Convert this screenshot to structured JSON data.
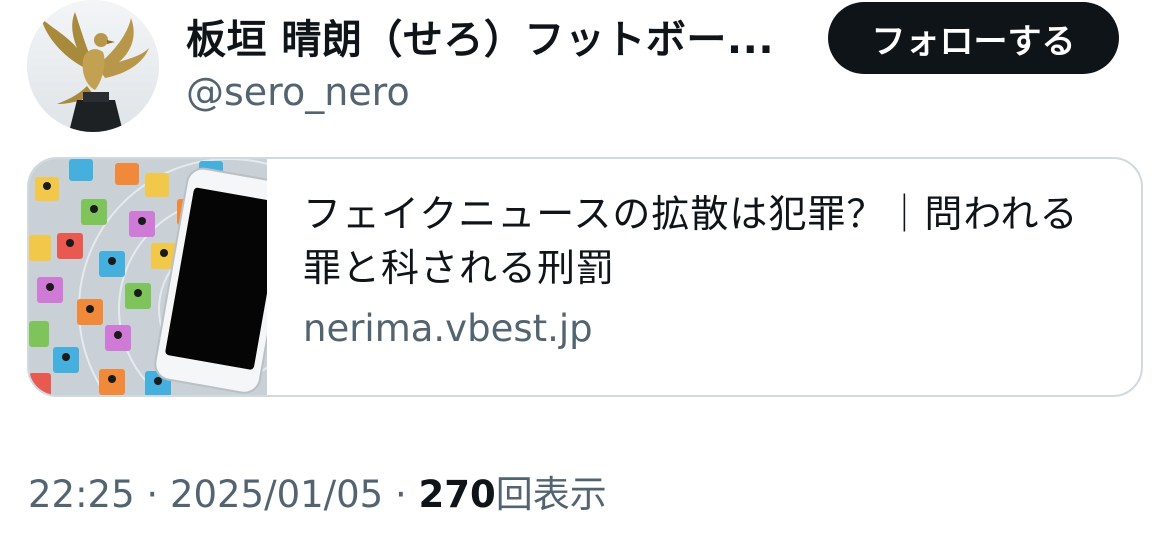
{
  "author": {
    "display_name": "板垣 晴朗（せろ）フットボー...",
    "handle": "@sero_nero",
    "avatar_icon": "phoenix-statue-avatar"
  },
  "follow_button": {
    "label": "フォローする"
  },
  "link_card": {
    "title": "フェイクニュースの拡散は犯罪？｜問われる罪と科される刑罰",
    "domain": "nerima.vbest.jp",
    "thumbnail_icon": "smartphone-people-blocks-image"
  },
  "meta": {
    "time": "22:25",
    "separator": "·",
    "date": "2025/01/05",
    "views_count": "270",
    "views_label": "回表示"
  },
  "colors": {
    "text_primary": "#0f1419",
    "text_secondary": "#536471",
    "button_bg": "#0f1419",
    "card_border": "#cfd9de"
  }
}
